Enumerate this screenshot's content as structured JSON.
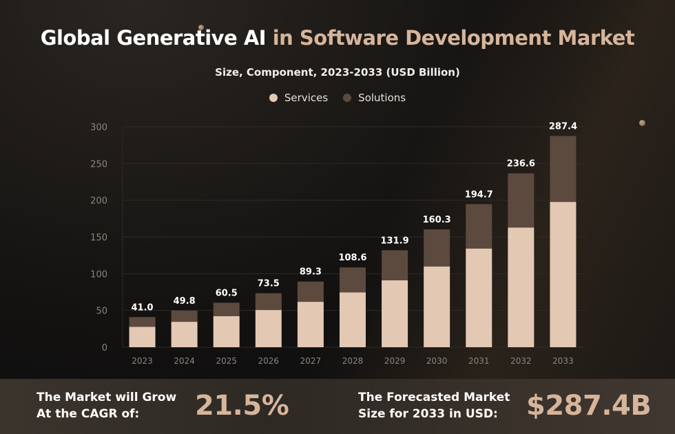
{
  "header": {
    "title_part1": "Global Generative AI",
    "title_part2": "in Software Development Market",
    "subtitle": "Size, Component, 2023-2033 (USD Billion)"
  },
  "colors": {
    "services": "#e3c8b4",
    "solutions": "#5c4a3e",
    "accent": "#d6b59b",
    "grid": "#2e2b29",
    "tick": "#8a8580"
  },
  "chart_data": {
    "type": "bar",
    "stacked": true,
    "title": "Global Generative AI in Software Development Market",
    "subtitle": "Size, Component, 2023-2033 (USD Billion)",
    "xlabel": "",
    "ylabel": "",
    "ylim": [
      0,
      300
    ],
    "yticks": [
      0,
      50,
      100,
      150,
      200,
      250,
      300
    ],
    "grid": true,
    "legend_position": "top-center",
    "categories": [
      "2023",
      "2024",
      "2025",
      "2026",
      "2027",
      "2028",
      "2029",
      "2030",
      "2031",
      "2032",
      "2033"
    ],
    "series": [
      {
        "name": "Services",
        "values": [
          27.7,
          34.6,
          42.3,
          50.6,
          61.8,
          74.6,
          91.1,
          109.9,
          134.3,
          162.9,
          197.7
        ]
      },
      {
        "name": "Solutions",
        "values": [
          13.3,
          15.2,
          18.2,
          22.9,
          27.5,
          34.0,
          40.8,
          50.4,
          60.4,
          73.7,
          89.7
        ]
      }
    ],
    "totals": [
      41.0,
      49.8,
      60.5,
      73.5,
      89.3,
      108.6,
      131.9,
      160.3,
      194.7,
      236.6,
      287.4
    ],
    "total_labels": [
      "41.0",
      "49.8",
      "60.5",
      "73.5",
      "89.3",
      "108.6",
      "131.9",
      "160.3",
      "194.7",
      "236.6",
      "287.4"
    ]
  },
  "stats": {
    "cagr_label_line1": "The Market will Grow",
    "cagr_label_line2": "At the CAGR of:",
    "cagr_value": "21.5%",
    "forecast_label_line1": "The Forecasted Market",
    "forecast_label_line2": "Size for 2033 in USD:",
    "forecast_value": "$287.4B"
  }
}
